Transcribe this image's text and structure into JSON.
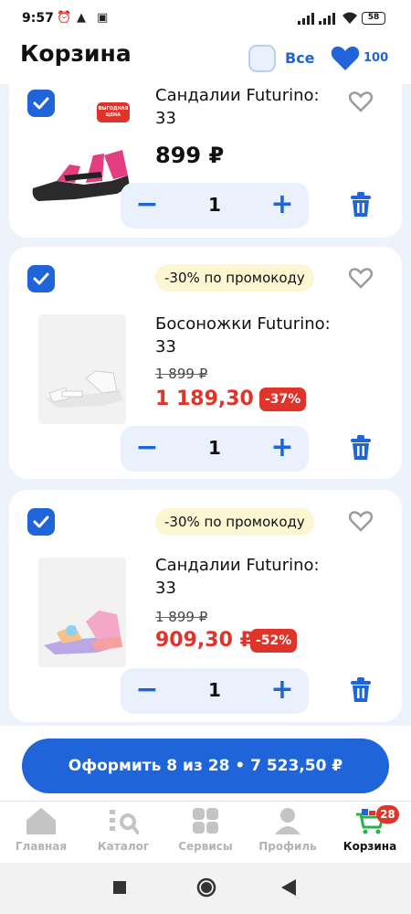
{
  "status_bar": {
    "time": "9:57",
    "battery": "58"
  },
  "header": {
    "title": "Корзина",
    "select_all_label": "Все",
    "favorites_count": "100"
  },
  "products": [
    {
      "name": "Сандалии Futurino: 33",
      "price": "899 ₽",
      "badge": "ВЫГОДНАЯ ЦЕНА",
      "quantity": "1"
    },
    {
      "promo": "-30% по промокоду",
      "name": "Босоножки Futurino: 33",
      "old_price": "1 899 ₽",
      "new_price": "1 189,30 ₽",
      "discount": "-37%",
      "quantity": "1"
    },
    {
      "promo": "-30% по промокоду",
      "name": "Сандалии Futurino: 33",
      "old_price": "1 899 ₽",
      "new_price": "909,30 ₽",
      "discount": "-52%",
      "quantity": "1"
    }
  ],
  "checkout": {
    "label": "Оформить 8 из 28 • 7 523,50 ₽"
  },
  "bottom_nav": {
    "items": [
      {
        "label": "Главная",
        "icon": "home-icon"
      },
      {
        "label": "Каталог",
        "icon": "catalog-icon"
      },
      {
        "label": "Сервисы",
        "icon": "services-icon"
      },
      {
        "label": "Профиль",
        "icon": "profile-icon"
      },
      {
        "label": "Корзина",
        "icon": "cart-icon"
      }
    ],
    "cart_badge": "28"
  },
  "colors": {
    "accent": "#1f64d8",
    "sale": "#e0342b",
    "promo_bg": "#fdf6d2",
    "page_bg": "#eef3fb"
  }
}
